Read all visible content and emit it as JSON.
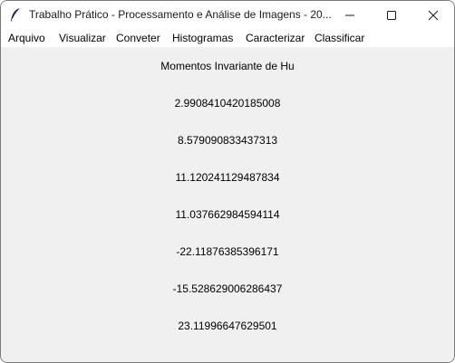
{
  "window": {
    "title": "Trabalho Prático - Processamento e Análise de Imagens - 20...",
    "app_icon": "feather-icon",
    "controls": [
      "minimize-icon",
      "maximize-icon",
      "close-icon"
    ]
  },
  "menu": {
    "items": [
      {
        "label": "Arquivo"
      },
      {
        "label": "Visualizar"
      },
      {
        "label": "Conveter"
      },
      {
        "label": "Histogramas"
      },
      {
        "label": "Caracterizar"
      },
      {
        "label": "Classificar"
      }
    ]
  },
  "content": {
    "heading": "Momentos Invariante de Hu",
    "values": [
      "2.9908410420185008",
      "8.579090833437313",
      "11.120241129487834",
      "11.037662984594114",
      "-22.11876385396171",
      "-15.528629006286437",
      "23.11996647629501"
    ]
  },
  "colors": {
    "titlebar_bg": "#ffffff",
    "content_bg": "#f0f0f0",
    "text": "#000000"
  }
}
